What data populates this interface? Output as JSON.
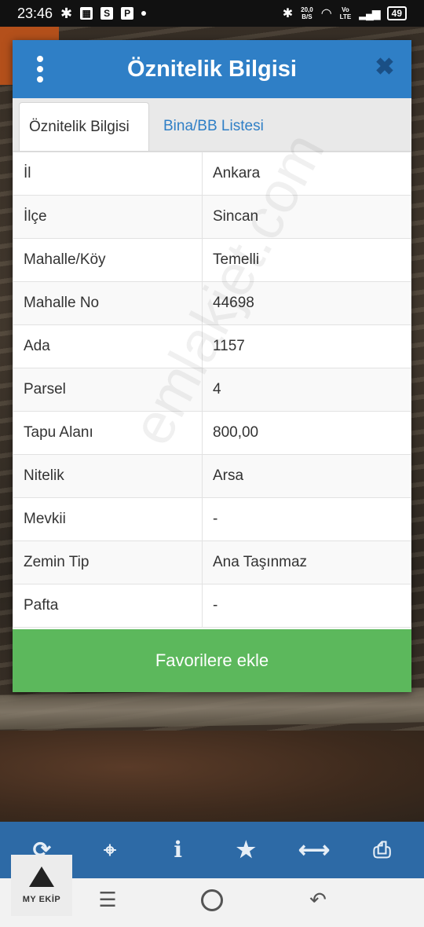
{
  "status_bar": {
    "time": "23:46",
    "speed_top": "20,0",
    "speed_bottom": "B/S",
    "network_top": "Vo",
    "network_bottom": "LTE",
    "battery": "49"
  },
  "dialog": {
    "title": "Öznitelik Bilgisi",
    "tabs": [
      {
        "label": "Öznitelik Bilgisi",
        "active": true
      },
      {
        "label": "Bina/BB Listesi",
        "active": false
      }
    ],
    "rows": [
      {
        "key": "İl",
        "value": "Ankara"
      },
      {
        "key": "İlçe",
        "value": "Sincan"
      },
      {
        "key": "Mahalle/Köy",
        "value": "Temelli"
      },
      {
        "key": "Mahalle No",
        "value": "44698"
      },
      {
        "key": "Ada",
        "value": "1157"
      },
      {
        "key": "Parsel",
        "value": "4"
      },
      {
        "key": "Tapu Alanı",
        "value": "800,00"
      },
      {
        "key": "Nitelik",
        "value": "Arsa"
      },
      {
        "key": "Mevkii",
        "value": "-"
      },
      {
        "key": "Zemin Tip",
        "value": "Ana Taşınmaz"
      },
      {
        "key": "Pafta",
        "value": "-"
      }
    ],
    "favorite_button": "Favorilere ekle"
  },
  "watermark": "emlakjet.com",
  "toolbar": {
    "icons": [
      "refresh-icon",
      "locate-icon",
      "info-icon",
      "star-icon",
      "measure-icon",
      "print-icon"
    ]
  },
  "logo": {
    "text": "MY EKİP"
  },
  "colors": {
    "header_blue": "#2f7fc6",
    "toolbar_blue": "#2d6aa6",
    "button_green": "#5cb85c"
  }
}
